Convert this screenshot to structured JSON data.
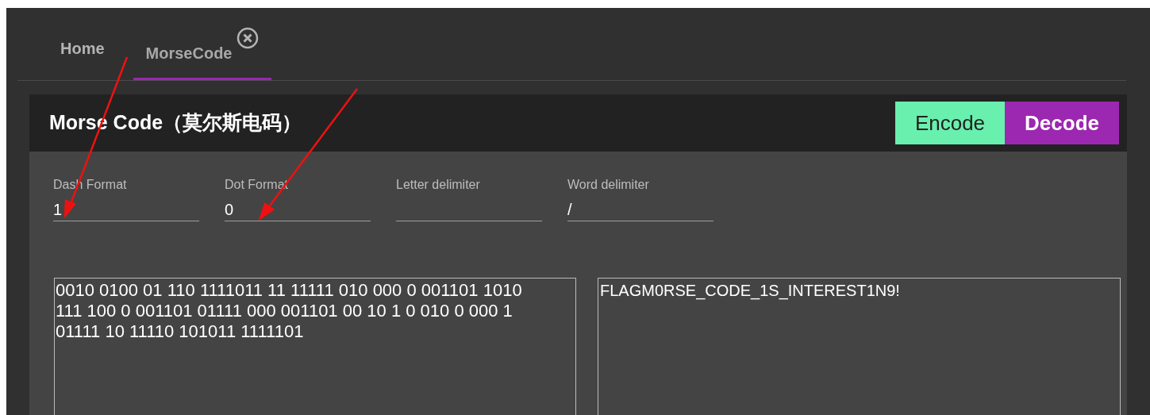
{
  "tabs": [
    {
      "label": "Home",
      "selected": false,
      "closable": false
    },
    {
      "label": "MorseCode",
      "selected": true,
      "closable": true
    }
  ],
  "panel": {
    "title": "Morse Code（莫尔斯电码）",
    "modes": [
      {
        "label": "Encode",
        "selected": false
      },
      {
        "label": "Decode",
        "selected": true
      }
    ]
  },
  "fields": [
    {
      "label": "Dash Format",
      "value": "1"
    },
    {
      "label": "Dot Format",
      "value": "0"
    },
    {
      "label": "Letter delimiter"
    },
    {
      "label": "Word delimiter",
      "value": "/"
    }
  ],
  "input": "0010 0100 01 110 1111011 11 11111 010 000 0 001101 1010 111 100 0 001101 01111 000 001101 00 10 1 0 010 0 000 1 01111 10 11110 101011 1111101",
  "output": "FLAGM0RSE_CODE_1S_INTEREST1N9!"
}
